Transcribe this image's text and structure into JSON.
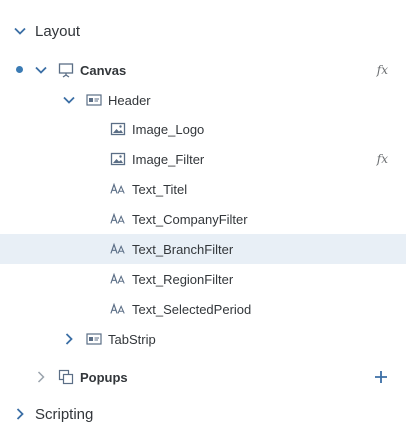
{
  "sections": {
    "layout_label": "Layout",
    "scripting_label": "Scripting"
  },
  "tree": {
    "canvas": {
      "label": "Canvas",
      "fx": "fx"
    },
    "header": {
      "label": "Header"
    },
    "image_logo": {
      "label": "Image_Logo"
    },
    "image_filter": {
      "label": "Image_Filter",
      "fx": "fx"
    },
    "text_titel": {
      "label": "Text_Titel"
    },
    "text_companyfilter": {
      "label": "Text_CompanyFilter"
    },
    "text_branchfilter": {
      "label": "Text_BranchFilter"
    },
    "text_regionfilter": {
      "label": "Text_RegionFilter"
    },
    "text_selectedperiod": {
      "label": "Text_SelectedPeriod"
    },
    "tabstrip": {
      "label": "TabStrip"
    },
    "popups": {
      "label": "Popups"
    }
  },
  "colors": {
    "selected_row": "#e8eff6",
    "accent_blue": "#3b7bb4",
    "icon_gray": "#5b6e86"
  }
}
